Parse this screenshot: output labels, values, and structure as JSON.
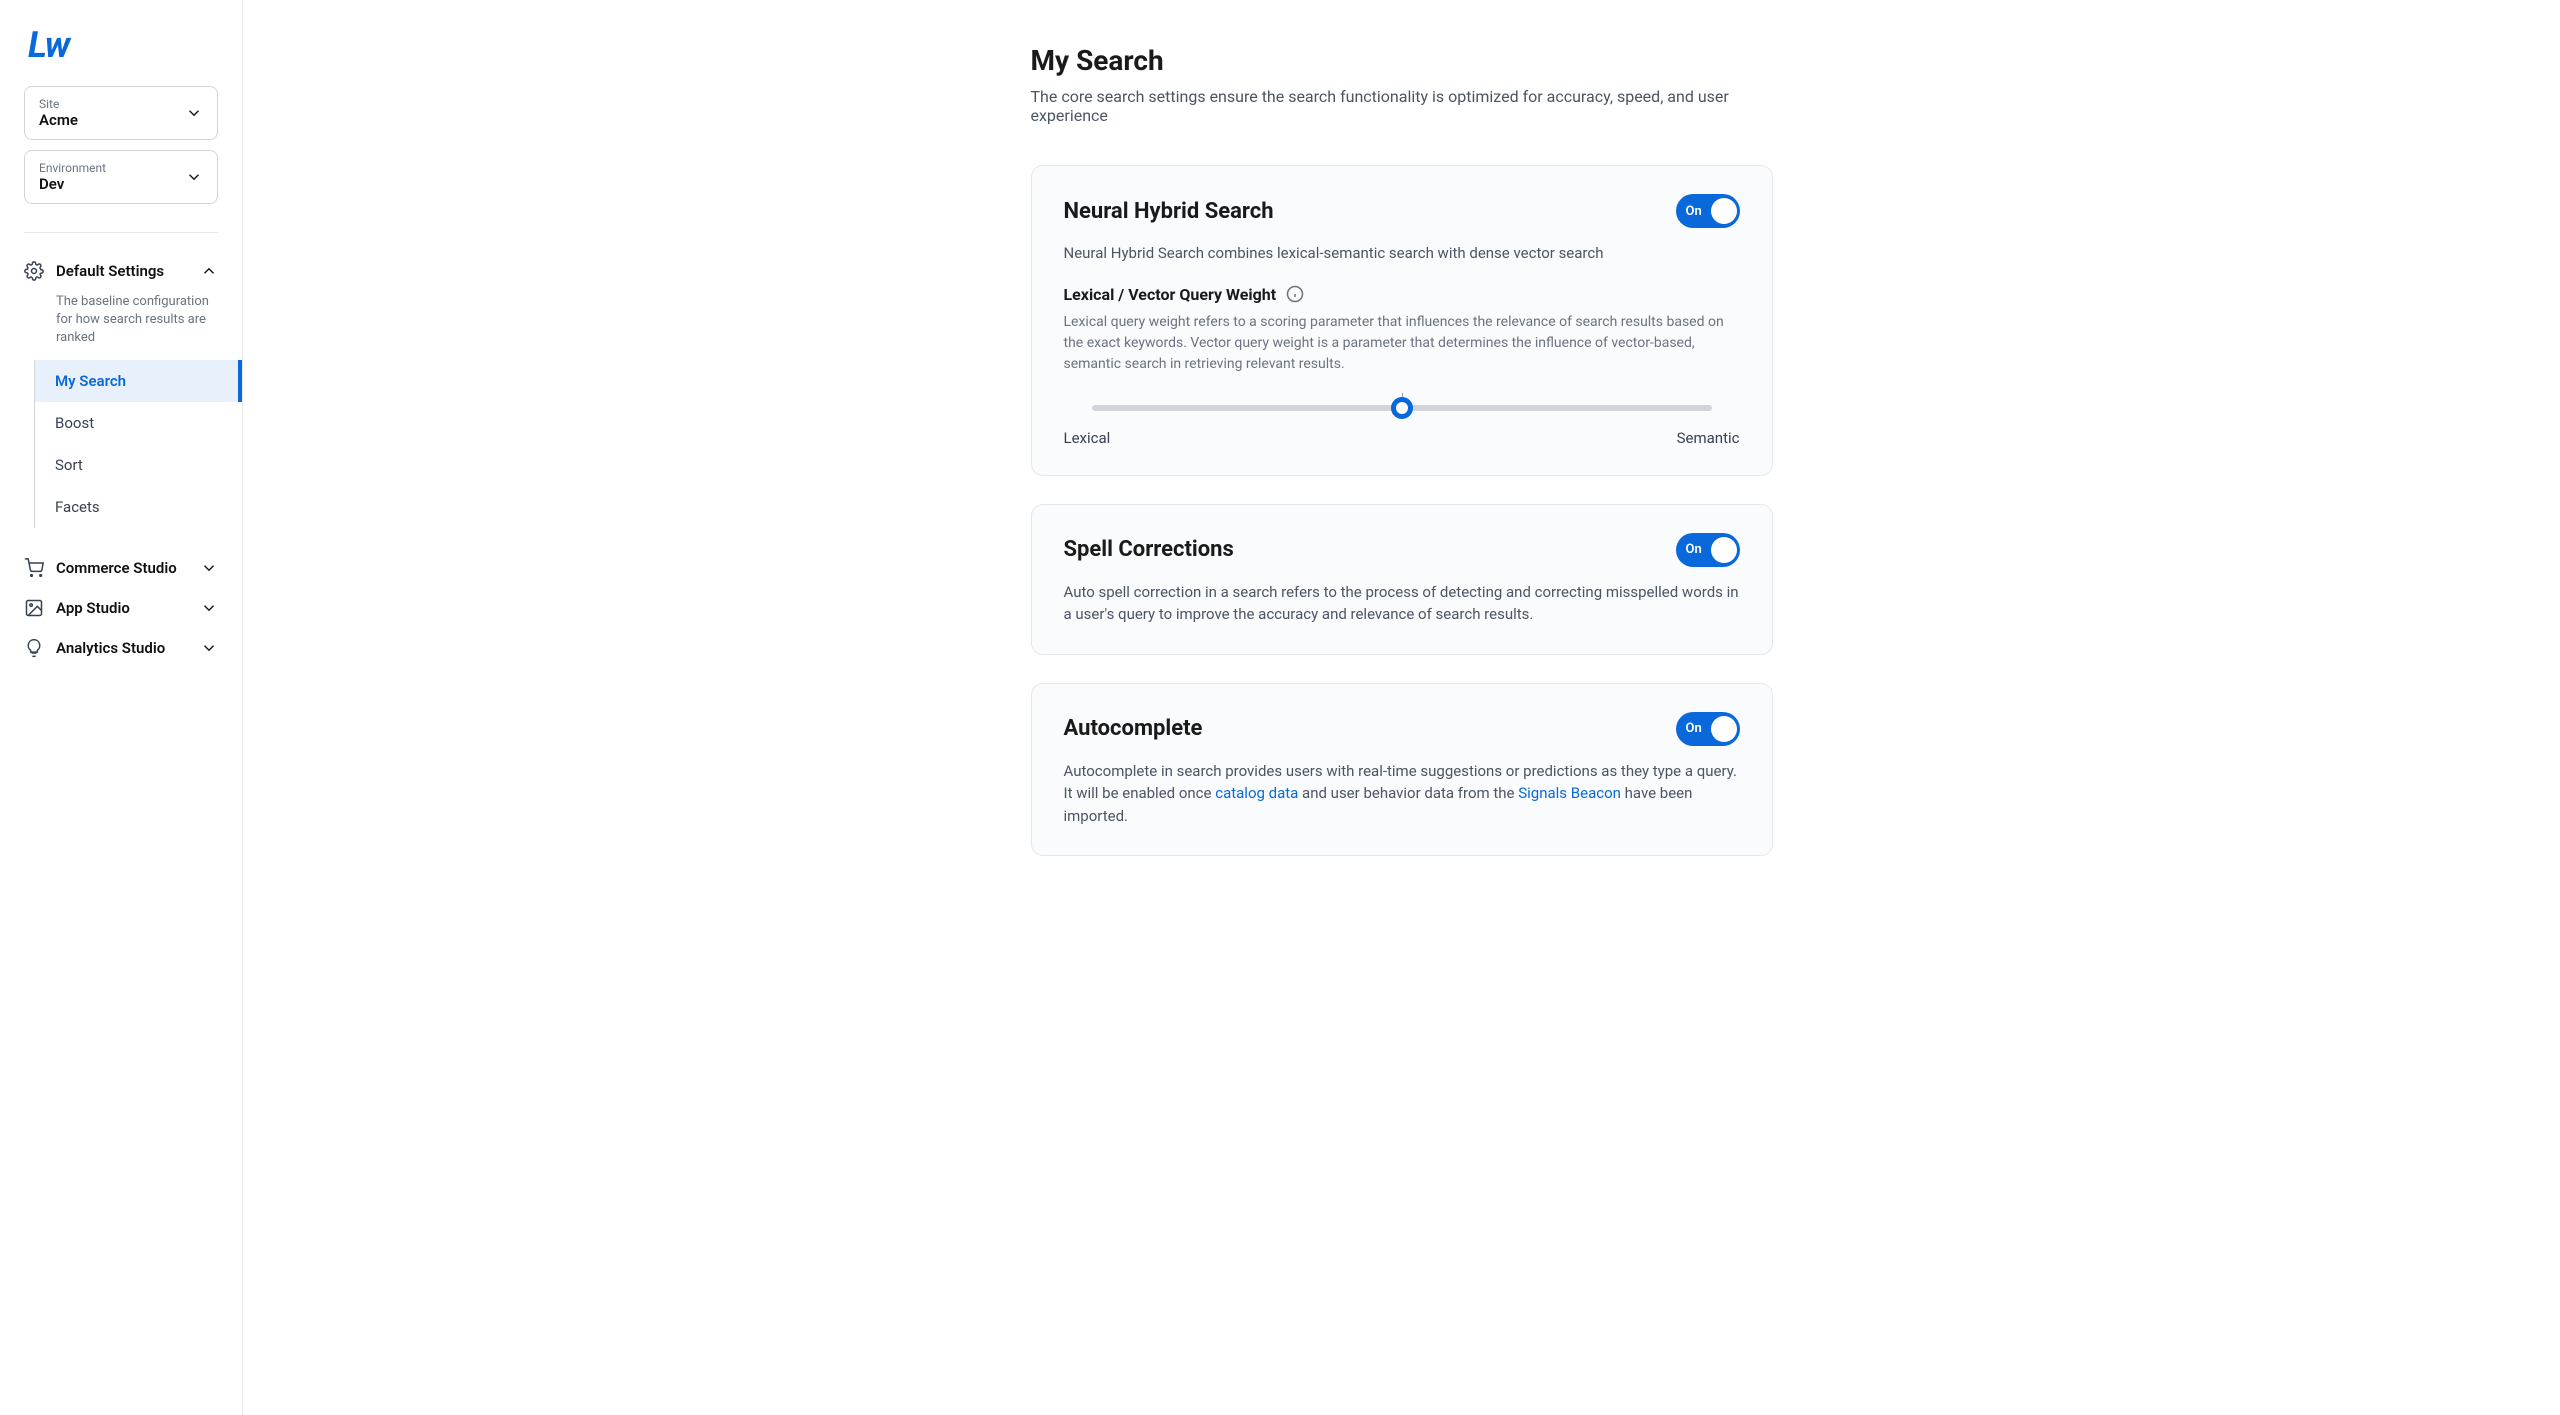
{
  "logo": "Lw",
  "selectors": {
    "site": {
      "label": "Site",
      "value": "Acme"
    },
    "environment": {
      "label": "Environment",
      "value": "Dev"
    }
  },
  "nav": {
    "default_settings": {
      "title": "Default Settings",
      "description": "The baseline configuration for how search results are ranked",
      "items": [
        "My Search",
        "Boost",
        "Sort",
        "Facets"
      ],
      "active_index": 0
    },
    "sections": [
      {
        "title": "Commerce Studio",
        "icon": "cart"
      },
      {
        "title": "App Studio",
        "icon": "image"
      },
      {
        "title": "Analytics Studio",
        "icon": "bulb"
      }
    ]
  },
  "page": {
    "title": "My Search",
    "subtitle": "The core search settings ensure the search functionality is optimized for accuracy, speed, and user experience"
  },
  "cards": {
    "neural": {
      "title": "Neural Hybrid Search",
      "description": "Neural Hybrid Search combines lexical-semantic search with dense vector search",
      "toggle": "On",
      "weight": {
        "title": "Lexical / Vector Query Weight",
        "description": "Lexical query weight refers to a scoring parameter that influences the relevance of search results based on the exact keywords. Vector query weight is a parameter that determines the influence of vector-based, semantic search in retrieving relevant results.",
        "left": "Lexical",
        "right": "Semantic",
        "value": 50
      }
    },
    "spell": {
      "title": "Spell Corrections",
      "description": "Auto spell correction in a search refers to the process of detecting and correcting misspelled words in a user's query to improve the accuracy and relevance of search results.",
      "toggle": "On"
    },
    "autocomplete": {
      "title": "Autocomplete",
      "desc_prefix": "Autocomplete in search provides users with real-time suggestions or predictions as they type a query. It will be enabled once ",
      "link1": "catalog data",
      "desc_mid": " and user behavior data from the ",
      "link2": "Signals Beacon",
      "desc_suffix": " have been imported.",
      "toggle": "On"
    }
  }
}
